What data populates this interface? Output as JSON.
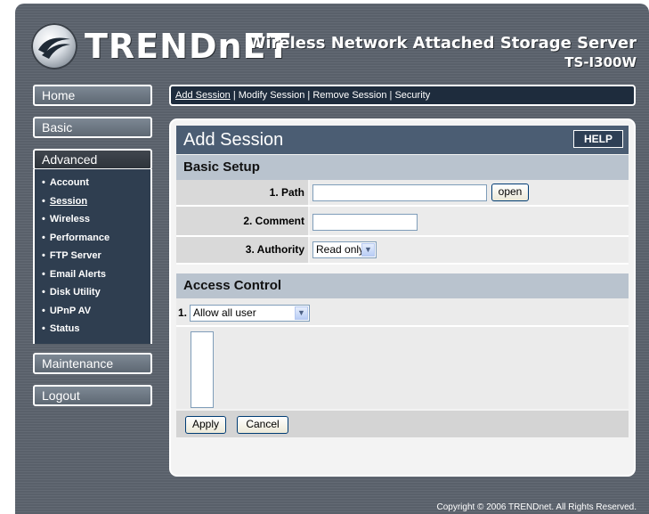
{
  "header": {
    "brand": "TRENDnET",
    "product_title": "Wireless Network Attached Storage Server",
    "model": "TS-I300W"
  },
  "nav": {
    "home": "Home",
    "basic": "Basic",
    "advanced": "Advanced",
    "advanced_items": [
      "Account",
      "Session",
      "Wireless",
      "Performance",
      "FTP Server",
      "Email Alerts",
      "Disk Utility",
      "UPnP AV",
      "Status"
    ],
    "maintenance": "Maintenance",
    "logout": "Logout"
  },
  "linkbar": {
    "links": [
      "Add Session",
      "Modify Session",
      "Remove Session",
      "Security"
    ],
    "separator": " | "
  },
  "panel": {
    "title": "Add Session",
    "help": "HELP",
    "basic_setup": "Basic Setup",
    "path_label": "1. Path",
    "path_value": "",
    "open_button": "open",
    "comment_label": "2. Comment",
    "comment_value": "",
    "authority_label": "3. Authority",
    "authority_selected": "Read only",
    "access_control": "Access Control",
    "access_prefix": "1.",
    "access_selected": "Allow all user",
    "apply": "Apply",
    "cancel": "Cancel"
  },
  "footer": {
    "copyright": "Copyright © 2006 TRENDnet. All Rights Reserved."
  },
  "colors": {
    "frame": "#5f6670",
    "nav_active": "#333a42",
    "submenu": "#2f3e50",
    "title_bar": "#4b5d73",
    "section_header": "#b9c3ce"
  }
}
